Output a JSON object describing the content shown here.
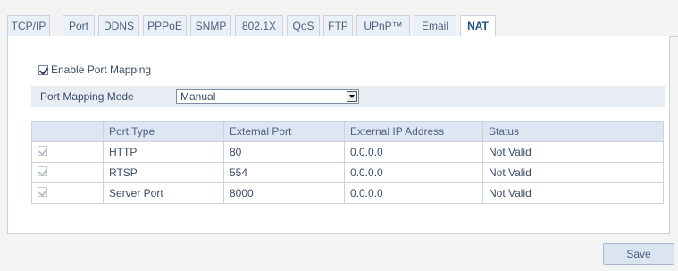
{
  "tabs": [
    "TCP/IP",
    "Port",
    "DDNS",
    "PPPoE",
    "SNMP",
    "802.1X",
    "QoS",
    "FTP",
    "UPnP™",
    "Email",
    "NAT"
  ],
  "active_tab": "NAT",
  "enable_port_mapping": {
    "label": "Enable Port Mapping",
    "checked": true
  },
  "mode": {
    "label": "Port Mapping Mode",
    "value": "Manual"
  },
  "table": {
    "headers": [
      "",
      "Port Type",
      "External Port",
      "External IP Address",
      "Status"
    ],
    "rows": [
      {
        "checked": true,
        "port_type": "HTTP",
        "external_port": "80",
        "external_ip": "0.0.0.0",
        "status": "Not Valid"
      },
      {
        "checked": true,
        "port_type": "RTSP",
        "external_port": "554",
        "external_ip": "0.0.0.0",
        "status": "Not Valid"
      },
      {
        "checked": true,
        "port_type": "Server Port",
        "external_port": "8000",
        "external_ip": "0.0.0.0",
        "status": "Not Valid"
      }
    ]
  },
  "save_label": "Save"
}
